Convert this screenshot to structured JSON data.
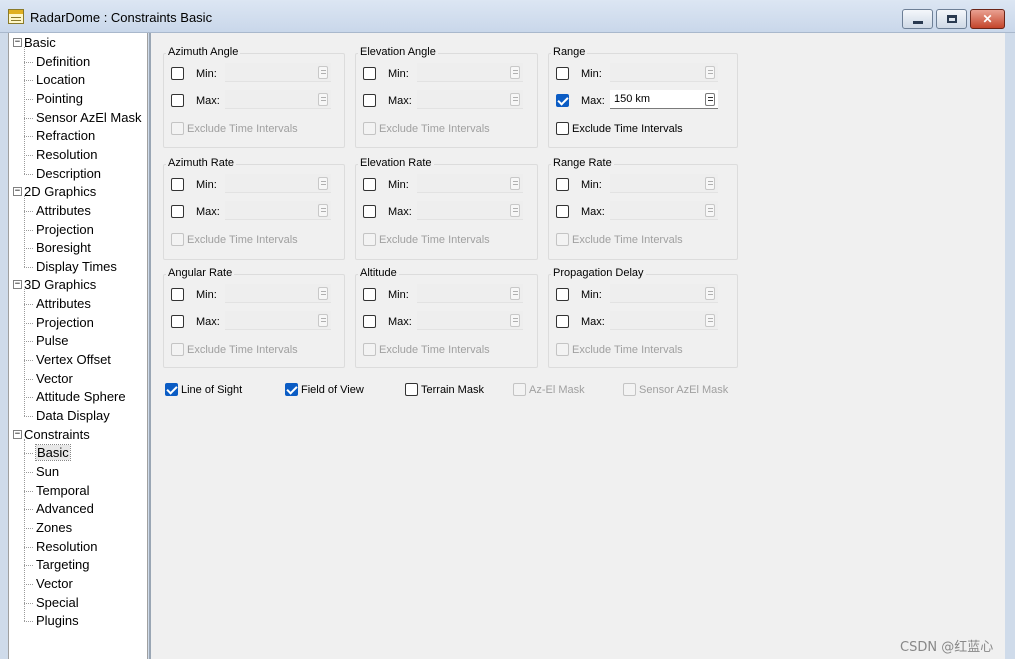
{
  "window": {
    "title": "RadarDome : Constraints Basic",
    "close_glyph": "✕"
  },
  "tree": {
    "groups": [
      {
        "label": "Basic",
        "expander": "−",
        "children": [
          "Definition",
          "Location",
          "Pointing",
          "Sensor AzEl Mask",
          "Refraction",
          "Resolution",
          "Description"
        ]
      },
      {
        "label": "2D Graphics",
        "expander": "−",
        "children": [
          "Attributes",
          "Projection",
          "Boresight",
          "Display Times"
        ]
      },
      {
        "label": "3D Graphics",
        "expander": "−",
        "children": [
          "Attributes",
          "Projection",
          "Pulse",
          "Vertex Offset",
          "Vector",
          "Attitude Sphere",
          "Data Display"
        ]
      },
      {
        "label": "Constraints",
        "expander": "−",
        "children": [
          "Basic",
          "Sun",
          "Temporal",
          "Advanced",
          "Zones",
          "Resolution",
          "Targeting",
          "Vector",
          "Special",
          "Plugins"
        ]
      }
    ],
    "selected": "Constraints/Basic"
  },
  "groups": [
    {
      "title": "Azimuth Angle",
      "min_label": "Min:",
      "max_label": "Max:",
      "min_checked": false,
      "max_checked": false,
      "max_value": "",
      "exclude_label": "Exclude Time Intervals",
      "exclude_enabled": false
    },
    {
      "title": "Elevation Angle",
      "min_label": "Min:",
      "max_label": "Max:",
      "min_checked": false,
      "max_checked": false,
      "max_value": "",
      "exclude_label": "Exclude Time Intervals",
      "exclude_enabled": false
    },
    {
      "title": "Range",
      "min_label": "Min:",
      "max_label": "Max:",
      "min_checked": false,
      "max_checked": true,
      "max_value": "150 km",
      "exclude_label": "Exclude Time Intervals",
      "exclude_enabled": true
    },
    {
      "title": "Azimuth Rate",
      "min_label": "Min:",
      "max_label": "Max:",
      "min_checked": false,
      "max_checked": false,
      "max_value": "",
      "exclude_label": "Exclude Time Intervals",
      "exclude_enabled": false
    },
    {
      "title": "Elevation Rate",
      "min_label": "Min:",
      "max_label": "Max:",
      "min_checked": false,
      "max_checked": false,
      "max_value": "",
      "exclude_label": "Exclude Time Intervals",
      "exclude_enabled": false
    },
    {
      "title": "Range Rate",
      "min_label": "Min:",
      "max_label": "Max:",
      "min_checked": false,
      "max_checked": false,
      "max_value": "",
      "exclude_label": "Exclude Time Intervals",
      "exclude_enabled": false
    },
    {
      "title": "Angular Rate",
      "min_label": "Min:",
      "max_label": "Max:",
      "min_checked": false,
      "max_checked": false,
      "max_value": "",
      "exclude_label": "Exclude Time Intervals",
      "exclude_enabled": false
    },
    {
      "title": "Altitude",
      "min_label": "Min:",
      "max_label": "Max:",
      "min_checked": false,
      "max_checked": false,
      "max_value": "",
      "exclude_label": "Exclude Time Intervals",
      "exclude_enabled": false
    },
    {
      "title": "Propagation Delay",
      "min_label": "Min:",
      "max_label": "Max:",
      "min_checked": false,
      "max_checked": false,
      "max_value": "",
      "exclude_label": "Exclude Time Intervals",
      "exclude_enabled": false
    }
  ],
  "bottom_checks": [
    {
      "label": "Line of Sight",
      "checked": true,
      "enabled": true
    },
    {
      "label": "Field of View",
      "checked": true,
      "enabled": true
    },
    {
      "label": "Terrain Mask",
      "checked": false,
      "enabled": true
    },
    {
      "label": "Az-El Mask",
      "checked": false,
      "enabled": false
    },
    {
      "label": "Sensor AzEl Mask",
      "checked": false,
      "enabled": false
    }
  ],
  "watermark": "CSDN @红蓝心",
  "colors": {
    "accent": "#0b5cc4",
    "panel_bg": "#f0f0f0",
    "frame": "#cfdbea"
  }
}
